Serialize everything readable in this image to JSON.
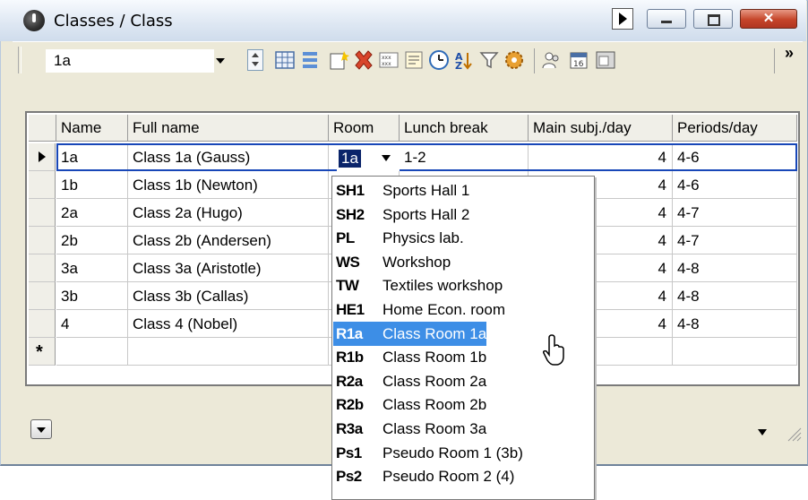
{
  "window": {
    "title": "Classes / Class",
    "controls": {
      "minimize": "minimize",
      "maximize": "maximize",
      "close": "✕"
    }
  },
  "toolbar": {
    "class_select_value": "1a",
    "overflow": "»",
    "icons": [
      "grid-icon",
      "list-icon",
      "new-icon",
      "delete-icon",
      "table-icon",
      "report-icon",
      "clock-icon",
      "sort-icon",
      "filter-icon",
      "settings-icon",
      "people-icon",
      "calendar-icon",
      "window-icon"
    ]
  },
  "grid": {
    "columns": [
      "Name",
      "Full name",
      "Room",
      "Lunch break",
      "Main subj./day",
      "Periods/day"
    ],
    "rows": [
      {
        "name": "1a",
        "full_name": "Class 1a (Gauss)",
        "room": "1a",
        "lunch": "1-2",
        "main_subj": "4",
        "periods": "4-6"
      },
      {
        "name": "1b",
        "full_name": "Class 1b (Newton)",
        "room": "",
        "lunch": "",
        "main_subj": "4",
        "periods": "4-6"
      },
      {
        "name": "2a",
        "full_name": "Class 2a (Hugo)",
        "room": "",
        "lunch": "",
        "main_subj": "4",
        "periods": "4-7"
      },
      {
        "name": "2b",
        "full_name": "Class 2b (Andersen)",
        "room": "",
        "lunch": "",
        "main_subj": "4",
        "periods": "4-7"
      },
      {
        "name": "3a",
        "full_name": "Class 3a (Aristotle)",
        "room": "",
        "lunch": "",
        "main_subj": "4",
        "periods": "4-8"
      },
      {
        "name": "3b",
        "full_name": "Class 3b (Callas)",
        "room": "",
        "lunch": "",
        "main_subj": "4",
        "periods": "4-8"
      },
      {
        "name": "4",
        "full_name": "Class 4 (Nobel)",
        "room": "",
        "lunch": "",
        "main_subj": "4",
        "periods": "4-8"
      }
    ],
    "new_row_marker": "*"
  },
  "room_dropdown": {
    "items": [
      {
        "code": "SH1",
        "name": "Sports Hall 1"
      },
      {
        "code": "SH2",
        "name": "Sports Hall 2"
      },
      {
        "code": "PL",
        "name": "Physics lab."
      },
      {
        "code": "WS",
        "name": "Workshop"
      },
      {
        "code": "TW",
        "name": "Textiles workshop"
      },
      {
        "code": "HE1",
        "name": "Home Econ. room"
      },
      {
        "code": "R1a",
        "name": "Class Room 1a"
      },
      {
        "code": "R1b",
        "name": "Class Room 1b"
      },
      {
        "code": "R2a",
        "name": "Class Room 2a"
      },
      {
        "code": "R2b",
        "name": "Class Room 2b"
      },
      {
        "code": "R3a",
        "name": "Class Room 3a"
      },
      {
        "code": "Ps1",
        "name": "Pseudo Room 1 (3b)"
      },
      {
        "code": "Ps2",
        "name": "Pseudo Room 2 (4)"
      }
    ],
    "highlighted_index": 6
  },
  "colors": {
    "selection": "#3d8ee6",
    "row_border": "#1847b8",
    "window_bg": "#ece9d8"
  }
}
